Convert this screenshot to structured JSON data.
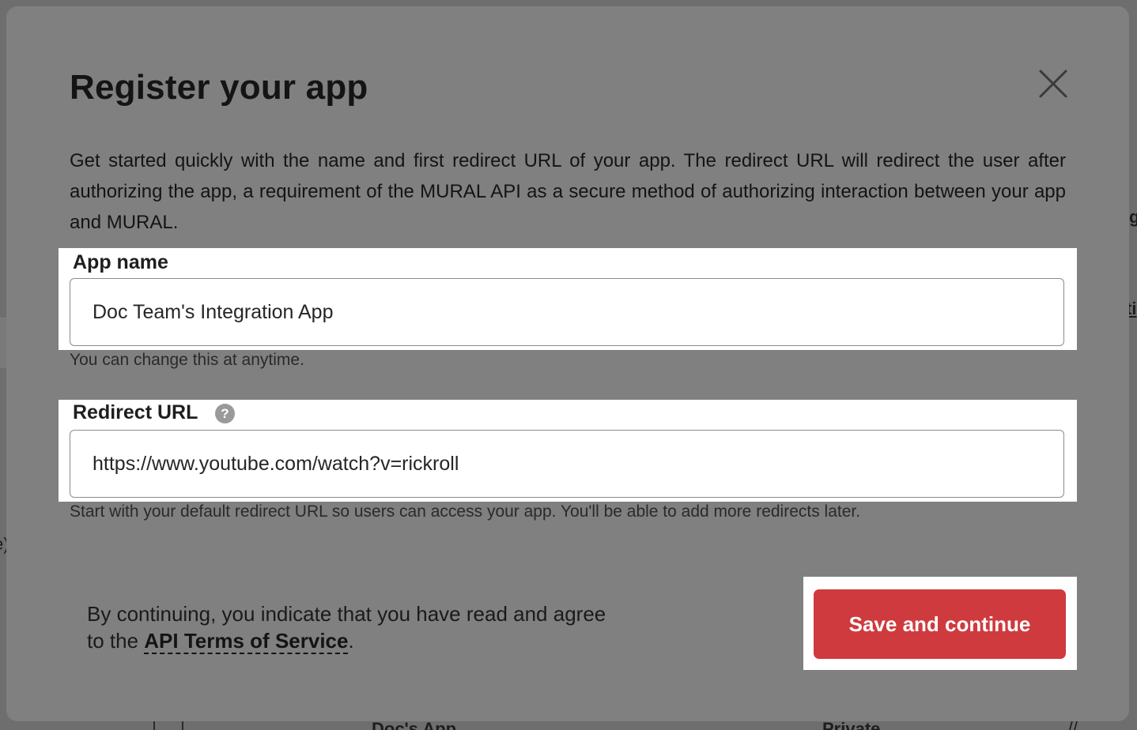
{
  "modal": {
    "title": "Register your app",
    "close_icon": "close-icon",
    "intro": "Get started quickly with the name and first redirect URL of your app. The redirect URL will redirect the user after authorizing the app, a requirement of the MURAL API as a secure method of authorizing interaction between your app and MURAL."
  },
  "form": {
    "app_name": {
      "label": "App name",
      "value": "Doc Team's Integration App",
      "hint": "You can change this at anytime."
    },
    "redirect_url": {
      "label": "Redirect URL",
      "help_icon": "question-circle-icon",
      "help_glyph": "?",
      "value": "https://www.youtube.com/watch?v=rickroll",
      "hint": "Start with your default redirect URL so users can access your app. You'll be able to add more redirects later."
    }
  },
  "footer": {
    "terms_prefix": "By continuing, you indicate that you have read and agree to the ",
    "terms_link": "API Terms of Service",
    "terms_suffix": ".",
    "save_button": "Save and continue"
  },
  "background": {
    "fragments": [
      "g",
      "ti",
      "e)",
      "Doc's App",
      "Private",
      "//"
    ]
  },
  "colors": {
    "overlay": "#6e6e6e",
    "modal": "#808080",
    "highlight": "#ffffff",
    "primary_button": "#cf3a3e"
  }
}
